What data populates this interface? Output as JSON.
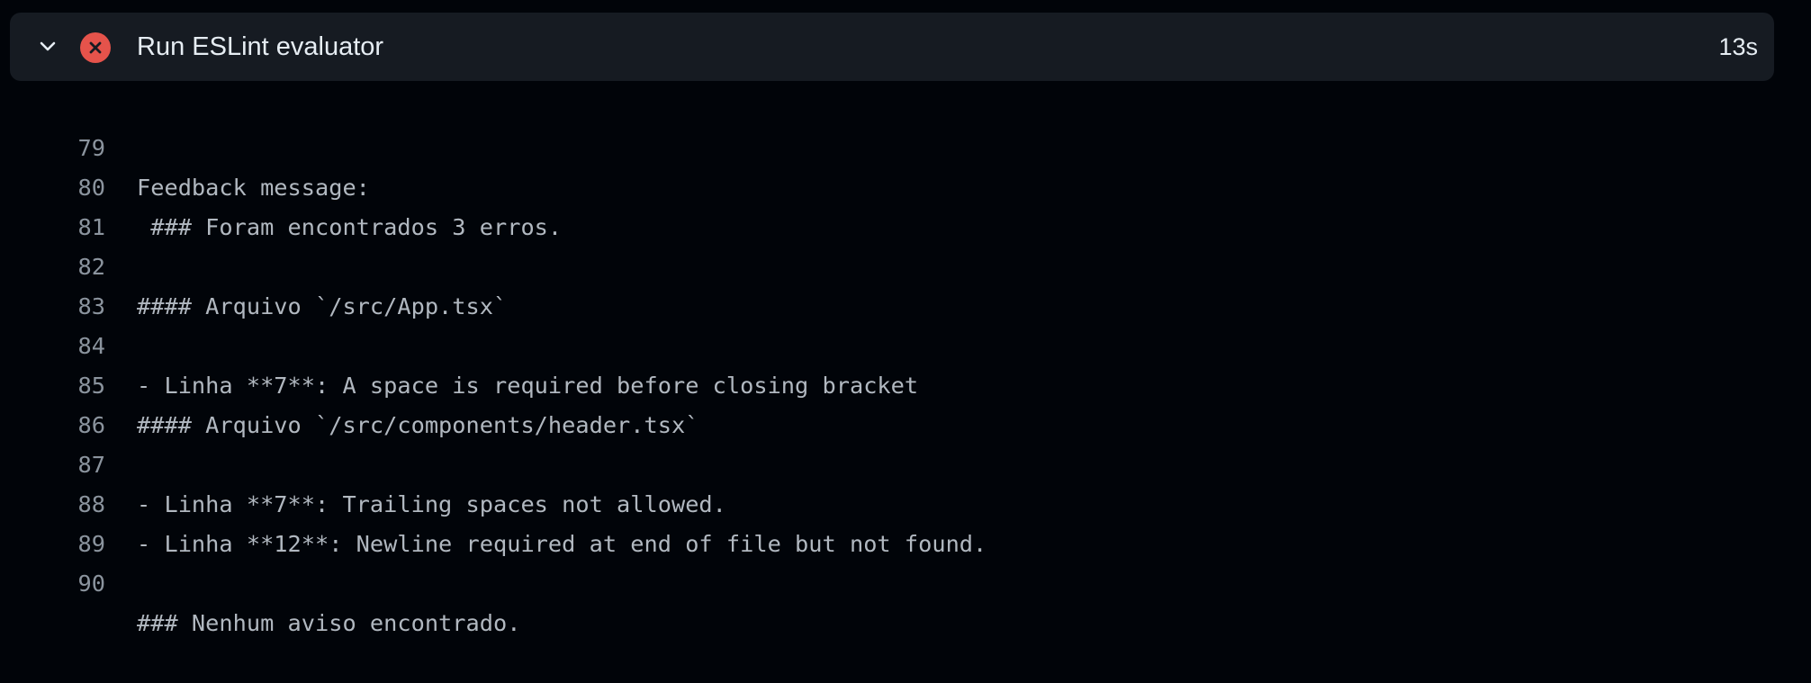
{
  "step": {
    "title": "Run ESLint evaluator",
    "duration": "13s",
    "status": "failed",
    "status_color": "#e5534b",
    "icons": {
      "toggle": "chevron-down-icon",
      "status": "x-circle-icon"
    }
  },
  "log": {
    "lines": [
      {
        "number": "79",
        "text": "Feedback message:"
      },
      {
        "number": "80",
        "text": " ### Foram encontrados 3 erros."
      },
      {
        "number": "81",
        "text": ""
      },
      {
        "number": "82",
        "text": "#### Arquivo `/src/App.tsx`"
      },
      {
        "number": "83",
        "text": ""
      },
      {
        "number": "84",
        "text": "- Linha **7**: A space is required before closing bracket"
      },
      {
        "number": "85",
        "text": "#### Arquivo `/src/components/header.tsx`"
      },
      {
        "number": "86",
        "text": ""
      },
      {
        "number": "87",
        "text": "- Linha **7**: Trailing spaces not allowed."
      },
      {
        "number": "88",
        "text": "- Linha **12**: Newline required at end of file but not found."
      },
      {
        "number": "89",
        "text": ""
      },
      {
        "number": "90",
        "text": "### Nenhum aviso encontrado."
      }
    ]
  }
}
